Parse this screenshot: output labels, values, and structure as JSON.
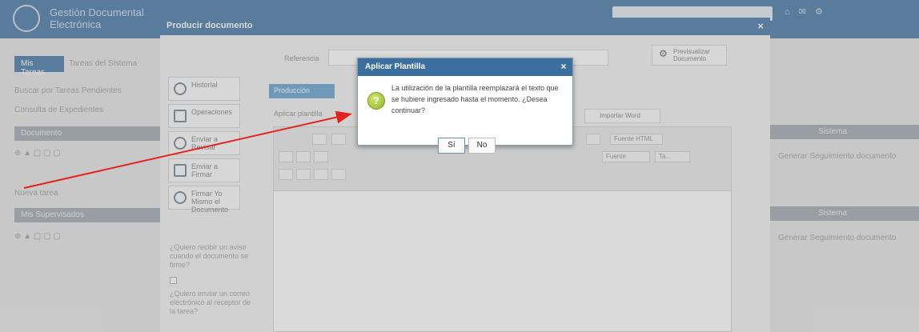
{
  "app": {
    "title": "Gestión Documental Electrónica",
    "subtitle": "",
    "user": "",
    "left_tab_active": "Mis Tareas",
    "left_tab_inactive": "Tareas del Sistema",
    "left_line1": "Buscar por Tareas Pendientes",
    "left_line2": "Consulta de Expedientes",
    "left_bar1": "Documento",
    "left_line3": "Nueva tarea",
    "left_bar2": "Mis Supervisados",
    "right_bar1": "Sistema",
    "right_line1": "Generar Seguimiento documento",
    "right_bar2": "Sistema",
    "right_line2": "Generar Seguimiento documento"
  },
  "window": {
    "title": "Producir documento",
    "close": "×",
    "side_buttons": [
      "Historial",
      "Operaciones",
      "Enviar a Revisar",
      "Enviar a Firmar",
      "Firmar Yo Mismo el Documento"
    ],
    "side_text1": "¿Quiero recibir un aviso cuando el documento se firme?",
    "side_text2": "¿Quiero enviar un correo electrónico al receptor de la tarea?",
    "ref_label": "Referencia",
    "fmt_button": "Previsualizar Documento",
    "prod_tab": "Producción",
    "plantilla_label": "Aplicar plantilla",
    "word_button": "Importar Word",
    "fuente_label": "Fuente",
    "size_label": "Ta...",
    "style_label": "Fuente HTML"
  },
  "dialog": {
    "title": "Aplicar Plantilla",
    "close": "×",
    "message": "La utilización de la plantilla reemplazará el texto que se hubiere ingresado hasta el momento. ¿Desea continuar?",
    "icon": "?",
    "yes": "Sí",
    "no": "No"
  },
  "colors": {
    "header_blue": "#3b6fa0",
    "tab_blue": "#5a9ccc",
    "arrow_red": "#e3231f"
  }
}
